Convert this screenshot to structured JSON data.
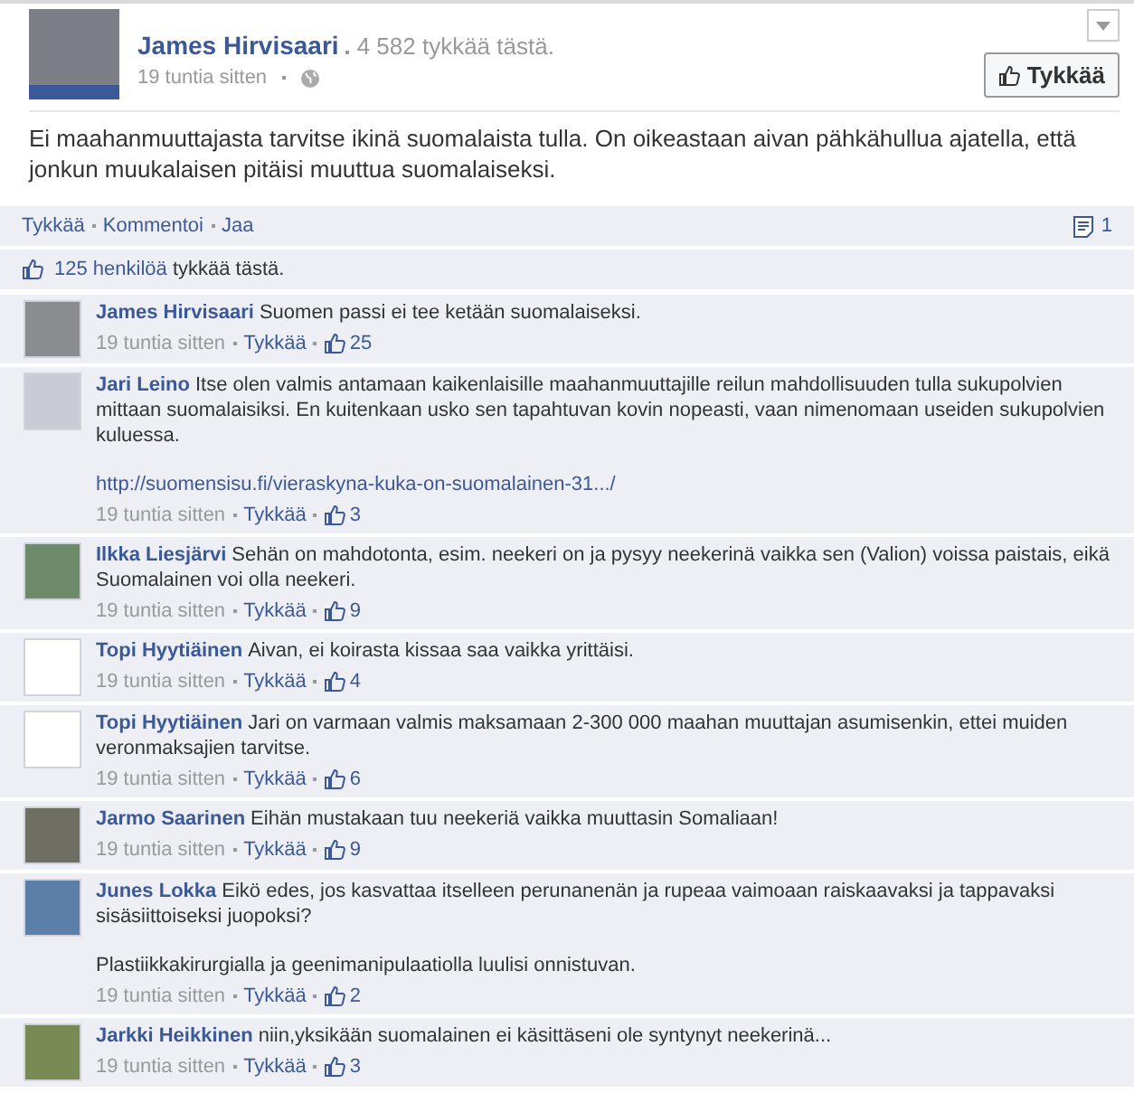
{
  "post": {
    "author": "James Hirvisaari",
    "page_likes": "4 582 tykkää tästä.",
    "time": "19 tuntia sitten",
    "like_button": "Tykkää",
    "text": "Ei maahanmuuttajasta tarvitse ikinä suomalaista tulla. On oikeastaan aivan pähkähullua ajatella, että jonkun muukalaisen pitäisi muuttua suomalaiseksi."
  },
  "actions": [
    "Tykkää",
    "Kommentoi",
    "Jaa"
  ],
  "comment_count": "1",
  "likes_summary": {
    "people": "125 henkilöä",
    "rest": "tykkää tästä."
  },
  "comments": [
    {
      "name": "James Hirvisaari",
      "paragraphs": [
        {
          "kind": "text",
          "text": "Suomen passi ei tee ketään suomalaiseksi."
        }
      ],
      "time": "19 tuntia sitten",
      "like": "Tykkää",
      "likes": "25"
    },
    {
      "name": "Jari Leino",
      "paragraphs": [
        {
          "kind": "text",
          "text": "Itse olen valmis antamaan kaikenlaisille maahanmuuttajille reilun mahdollisuuden tulla sukupolvien mittaan suomalaisiksi. En kuitenkaan usko sen tapahtuvan kovin nopeasti, vaan nimenomaan useiden sukupolvien kuluessa."
        },
        {
          "kind": "link",
          "text": "http://suomensisu.fi/vieraskyna-kuka-on-suomalainen-31.../"
        }
      ],
      "time": "19 tuntia sitten",
      "like": "Tykkää",
      "likes": "3"
    },
    {
      "name": "Ilkka Liesjärvi",
      "paragraphs": [
        {
          "kind": "text",
          "text": "Sehän on mahdotonta, esim. neekeri on ja pysyy neekerinä vaikka sen (Valion) voissa paistais, eikä Suomalainen voi olla neekeri."
        }
      ],
      "time": "19 tuntia sitten",
      "like": "Tykkää",
      "likes": "9"
    },
    {
      "name": "Topi Hyytiäinen",
      "paragraphs": [
        {
          "kind": "text",
          "text": "Aivan, ei koirasta kissaa saa vaikka yrittäisi."
        }
      ],
      "time": "19 tuntia sitten",
      "like": "Tykkää",
      "likes": "4"
    },
    {
      "name": "Topi Hyytiäinen",
      "paragraphs": [
        {
          "kind": "text",
          "text": "Jari on varmaan valmis maksamaan 2-300 000 maahan muuttajan asumisenkin, ettei muiden veronmaksajien tarvitse."
        }
      ],
      "time": "19 tuntia sitten",
      "like": "Tykkää",
      "likes": "6"
    },
    {
      "name": "Jarmo Saarinen",
      "paragraphs": [
        {
          "kind": "text",
          "text": "Eihän mustakaan tuu neekeriä vaikka muuttasin Somaliaan!"
        }
      ],
      "time": "19 tuntia sitten",
      "like": "Tykkää",
      "likes": "9"
    },
    {
      "name": "Junes Lokka",
      "paragraphs": [
        {
          "kind": "text",
          "text": "Eikö edes, jos kasvattaa itselleen perunanenän ja rupeaa vaimoaan raiskaavaksi ja tappavaksi sisäsiittoiseksi juopoksi?"
        },
        {
          "kind": "text",
          "text": "Plastiikkakirurgialla ja geenimanipulaatiolla luulisi onnistuvan."
        }
      ],
      "time": "19 tuntia sitten",
      "like": "Tykkää",
      "likes": "2"
    },
    {
      "name": "Jarkki Heikkinen",
      "paragraphs": [
        {
          "kind": "text",
          "text": "niin,yksikään suomalainen ei käsittäseni ole syntynyt neekerinä..."
        }
      ],
      "time": "19 tuntia sitten",
      "like": "Tykkää",
      "likes": "3"
    }
  ]
}
